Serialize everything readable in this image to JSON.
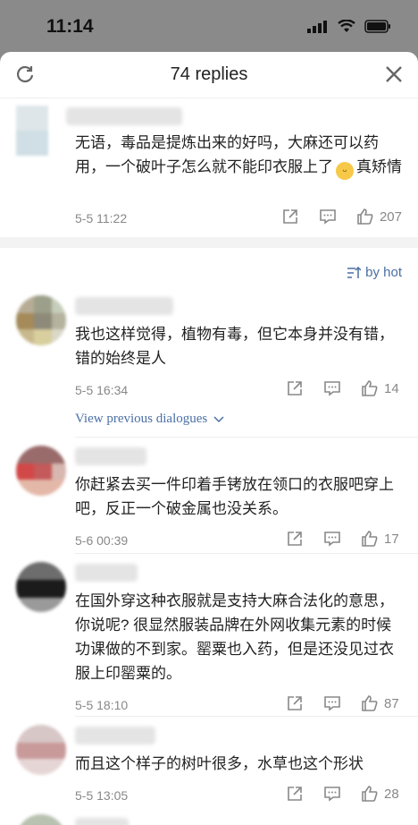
{
  "status_bar": {
    "time": "11:14"
  },
  "header": {
    "title": "74 replies"
  },
  "sort": {
    "label": "by hot"
  },
  "top_comment": {
    "text": "无语，毒品是提炼出来的好吗，大麻还可以药用，一个破叶子怎么就不能印衣服上了",
    "text_tail": "真矫情",
    "emoji": "sweat-smile-emoji",
    "date": "5-5 11:22",
    "likes": "207"
  },
  "replies": [
    {
      "text": "我也这样觉得，植物有毒，但它本身并没有错，错的始终是人",
      "date": "5-5 16:34",
      "likes": "14",
      "view_previous": "View previous dialogues"
    },
    {
      "text": "你赶紧去买一件印着手铐放在领口的衣服吧穿上吧，反正一个破金属也没关系。",
      "date": "5-6 00:39",
      "likes": "17"
    },
    {
      "text": "在国外穿这种衣服就是支持大麻合法化的意思，你说呢? 很显然服装品牌在外网收集元素的时候功课做的不到家。罂粟也入药，但是还没见过衣服上印罂粟的。",
      "date": "5-5 18:10",
      "likes": "87"
    },
    {
      "text": "而且这个样子的树叶很多，水草也这个形状",
      "date": "5-5 13:05",
      "likes": "28"
    }
  ],
  "colors": {
    "accent": "#4a6fa5",
    "meta": "#888888",
    "text": "#222222"
  },
  "icons": [
    "refresh-icon",
    "close-icon",
    "share-icon",
    "comment-icon",
    "thumbs-up-icon",
    "sort-icon",
    "chevron-down-icon"
  ]
}
